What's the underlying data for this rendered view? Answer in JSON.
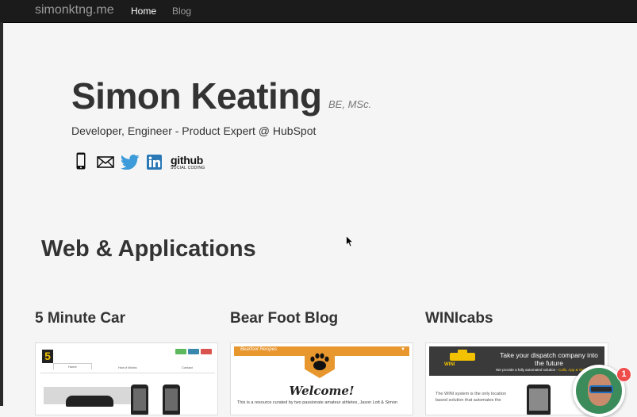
{
  "navbar": {
    "brand": "simonktng.me",
    "links": [
      {
        "label": "Home",
        "active": true
      },
      {
        "label": "Blog",
        "active": false
      }
    ]
  },
  "hero": {
    "name": "Simon Keating",
    "degree": "BE, MSc.",
    "tagline": "Developer, Engineer - Product Expert @ HubSpot",
    "social_icons": [
      "phone-icon",
      "mail-icon",
      "twitter-icon",
      "linkedin-icon",
      "github-icon"
    ],
    "github_logo_text": "github",
    "github_logo_sub": "SOCIAL CODING"
  },
  "section_title": "Web & Applications",
  "projects": [
    {
      "title": "5 Minute Car",
      "thumbnail": {
        "logo_text": "5",
        "tabs": [
          "Home",
          "How it Works",
          "Contact"
        ],
        "button_colors": [
          "#5cb85c",
          "#3a87ad",
          "#d9534f"
        ]
      }
    },
    {
      "title": "Bear Foot Blog",
      "thumbnail": {
        "brand": "Bearfoot Recipes",
        "welcome": "Welcome!",
        "intro_text": "This is a resource curated by two passionate amateur athletes, Jason Lott & Simon",
        "accent_color": "#e8962e"
      }
    },
    {
      "title": "WINIcabs",
      "thumbnail": {
        "logo_text": "WINI",
        "headline": "Take your dispatch company into the future",
        "sub_text": "We provide a fully automated solution - ",
        "sub_highlight": "Calls, App & Web Bookings",
        "body_text": "The WINI system is the only location based solution that automates the"
      }
    }
  ],
  "chat_widget": {
    "notification_count": "1"
  }
}
